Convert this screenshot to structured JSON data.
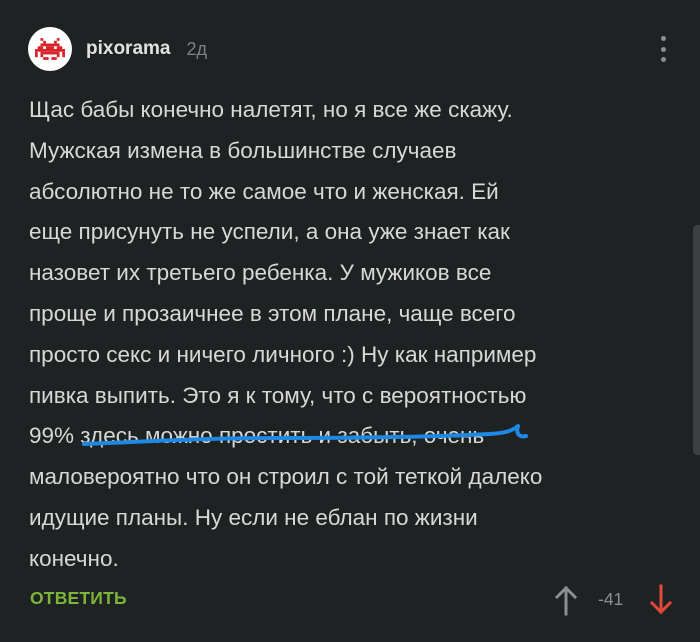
{
  "comment": {
    "author": "pixorama",
    "timestamp": "2д",
    "avatar_icon": "space-invader-icon",
    "body_lines": [
      "Щас бабы конечно налетят, но я все же скажу.",
      "Мужская измена в большинстве случаев",
      "абсолютно не то же самое что и женская. Ей",
      "еще присунуть не успели, а она уже знает как",
      "назовет их третьего ребенка. У мужиков все",
      "проще и прозаичнее в этом плане, чаще всего",
      "просто секс и ничего личного :) Ну как например",
      "пивка выпить. Это я к тому, что с вероятностью",
      "99% здесь можно простить и забыть, очень",
      "маловероятно что он строил с той теткой далеко",
      "идущие планы. Ну если не еблан по жизни",
      "конечно."
    ],
    "underline_color": "#1e88e5",
    "reply_label": "ОТВЕТИТЬ",
    "rating": "-41",
    "upvote_icon": "arrow-up-icon",
    "downvote_icon": "arrow-down-icon",
    "menu_icon": "more-vertical-icon",
    "colors": {
      "background": "#1f2223",
      "reply": "#7db43a",
      "downvote": "#e5473a",
      "muted": "#8a8f93",
      "avatar_red": "#d8232a"
    }
  }
}
